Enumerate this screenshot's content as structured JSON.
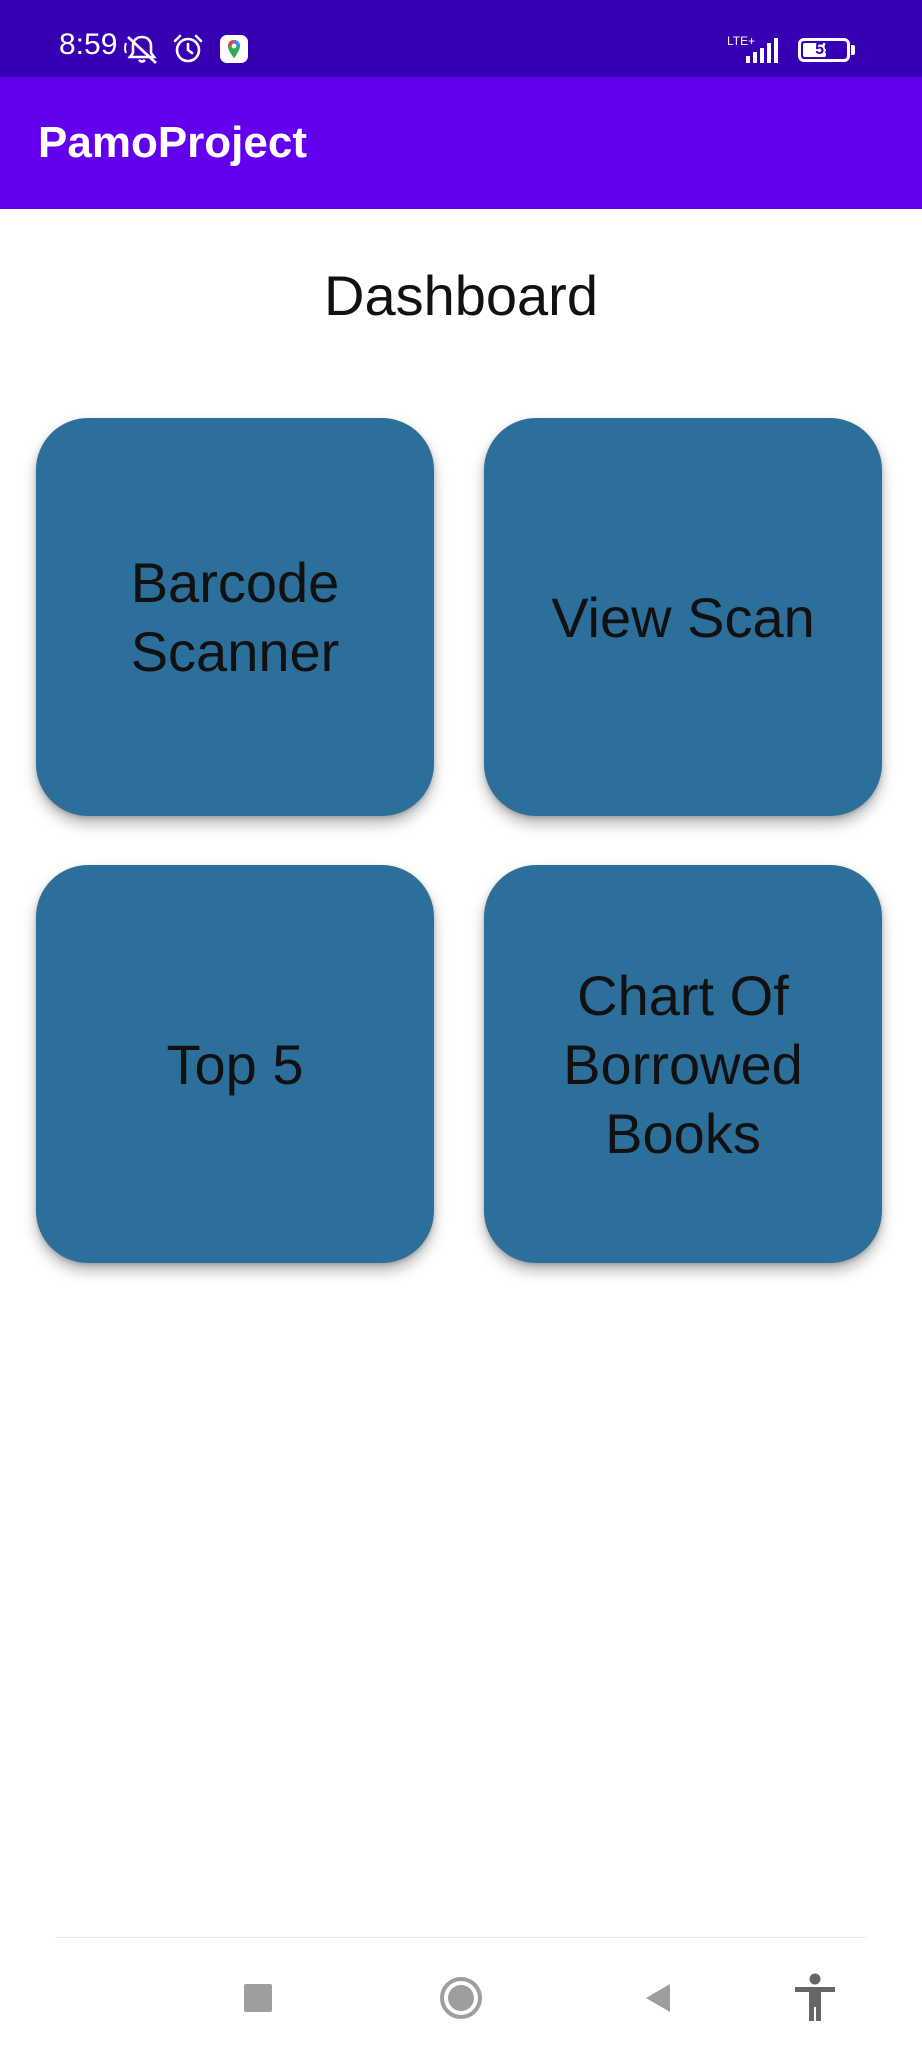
{
  "status_bar": {
    "time": "8:59",
    "network_label": "LTE+",
    "battery_level": 59,
    "battery_label": "59",
    "icons": [
      "muted-icon",
      "alarm-icon",
      "maps-icon",
      "signal-icon",
      "battery-icon"
    ]
  },
  "app_bar": {
    "title": "PamoProject"
  },
  "dashboard": {
    "title": "Dashboard",
    "tiles": [
      {
        "label": "Barcode\nScanner"
      },
      {
        "label": "View Scan"
      },
      {
        "label": "Top 5"
      },
      {
        "label": "Chart Of\nBorrowed\nBooks"
      }
    ]
  },
  "nav_bar": {
    "buttons": [
      "recents-icon",
      "home-icon",
      "back-icon",
      "accessibility-icon"
    ]
  },
  "colors": {
    "status_bar": "#3700b3",
    "app_bar": "#6200ee",
    "tile": "#2d6f9b",
    "text": "#111111"
  }
}
